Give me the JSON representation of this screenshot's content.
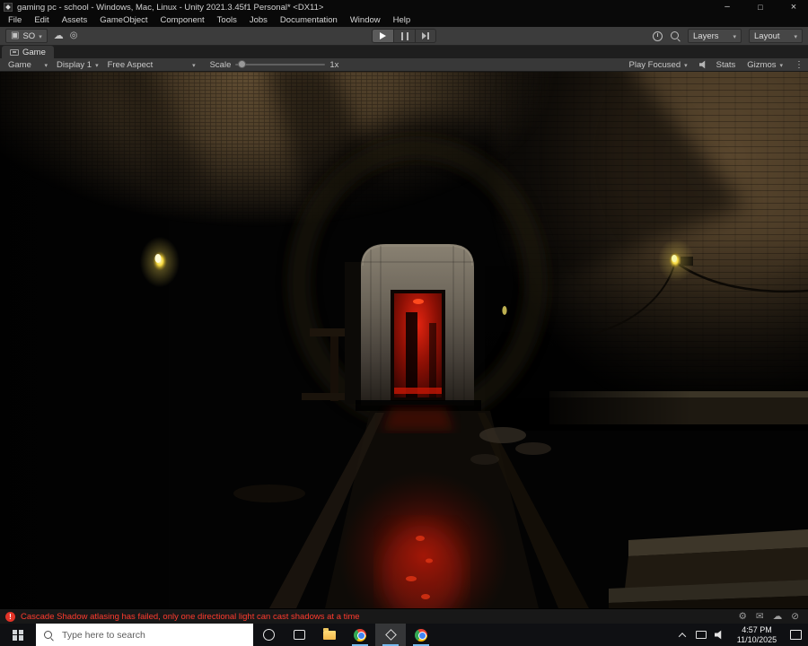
{
  "titlebar": {
    "title": "gaming pc - school - Windows, Mac, Linux - Unity 2021.3.45f1 Personal* <DX11>"
  },
  "menubar": {
    "items": [
      "File",
      "Edit",
      "Assets",
      "GameObject",
      "Component",
      "Tools",
      "Jobs",
      "Documentation",
      "Window",
      "Help"
    ]
  },
  "toolbar": {
    "account": "SO",
    "layers": "Layers",
    "layout": "Layout"
  },
  "game_tab": {
    "label": "Game"
  },
  "game_toolbar": {
    "display_mode": "Game",
    "display_target": "Display 1",
    "aspect": "Free Aspect",
    "scale_label": "Scale",
    "scale_value": "1x",
    "play_focused": "Play Focused",
    "stats": "Stats",
    "gizmos": "Gizmos"
  },
  "statusbar": {
    "error": "Cascade Shadow atlasing has failed, only one directional light can cast shadows at a time"
  },
  "taskbar": {
    "search_placeholder": "Type here to search",
    "time": "4:57 PM",
    "date": "11/10/2025"
  }
}
